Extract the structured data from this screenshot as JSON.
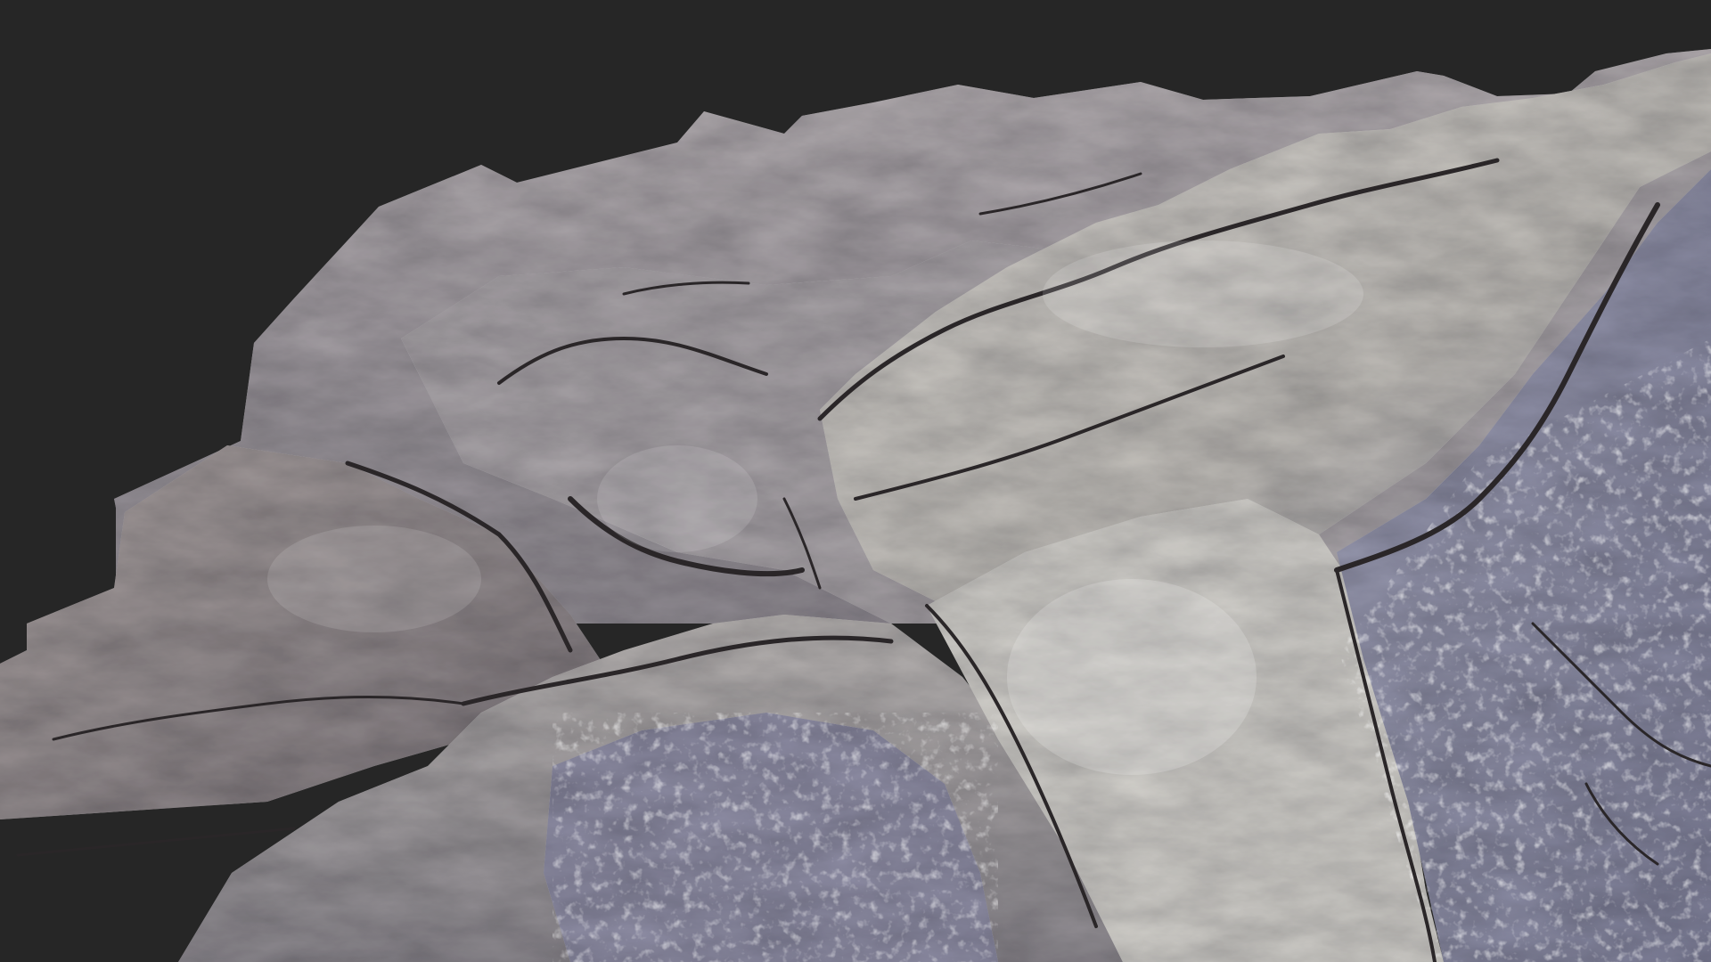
{
  "viewport": {
    "subject": "rock-scan-model",
    "background_color": "#262626"
  },
  "palette": {
    "rock_light": "#c9c6c2",
    "rock_mid": "#a29fa3",
    "rock_dark": "#5f5a5f",
    "rock_blue": "#8f90a6",
    "rock_warm": "#b8a9a4",
    "crack": "#2a2628"
  }
}
